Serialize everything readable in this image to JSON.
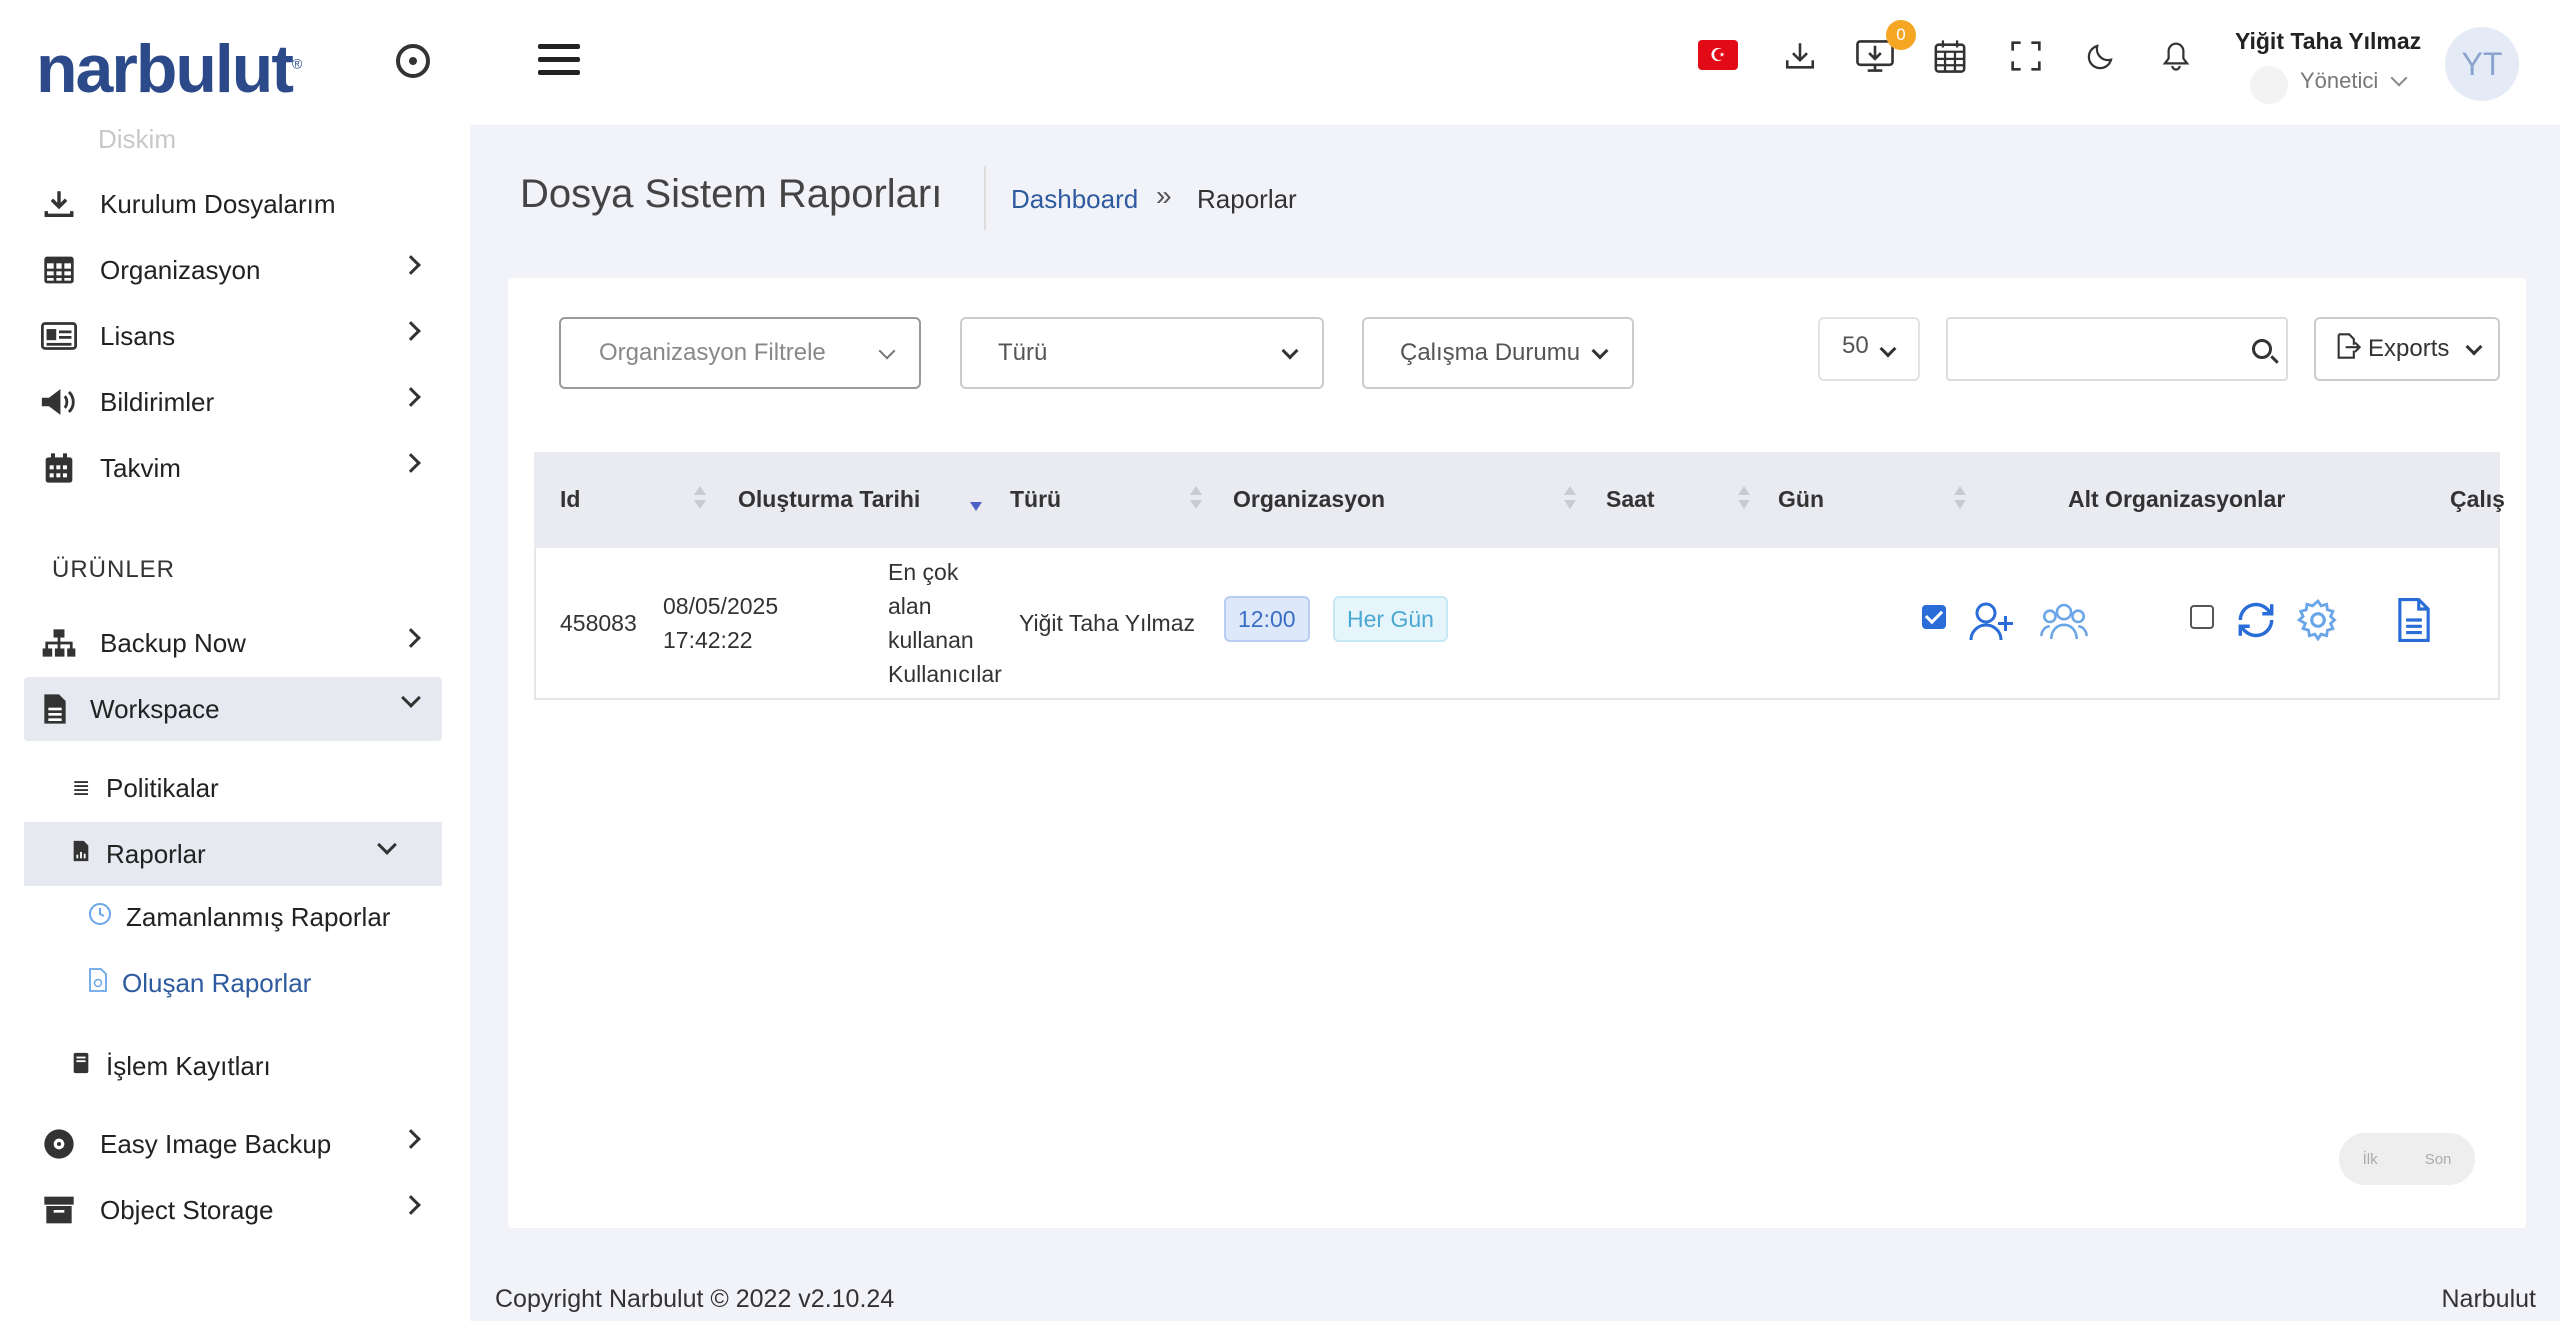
{
  "brand": {
    "logo": "narbulut",
    "logo_mark": "®"
  },
  "sidebar": {
    "ghost_item": "Diskim",
    "items": [
      {
        "label": "Kurulum Dosyalarım",
        "icon": "download-icon"
      },
      {
        "label": "Organizasyon",
        "icon": "table-grid-icon"
      },
      {
        "label": "Lisans",
        "icon": "id-card-icon"
      },
      {
        "label": "Bildirimler",
        "icon": "megaphone-icon"
      },
      {
        "label": "Takvim",
        "icon": "calendar-icon"
      }
    ],
    "section": "ÜRÜNLER",
    "products": [
      {
        "label": "Backup Now",
        "icon": "sitemap-icon"
      },
      {
        "label": "Workspace",
        "icon": "file-icon"
      }
    ],
    "workspace_children": [
      {
        "label": "Politikalar",
        "icon": "list-icon"
      },
      {
        "label": "Raporlar",
        "icon": "file-chart-icon"
      }
    ],
    "raporlar_children": [
      {
        "label": "Zamanlanmış Raporlar",
        "icon": "clock-icon"
      },
      {
        "label": "Oluşan Raporlar",
        "icon": "file-doc-icon"
      }
    ],
    "islem": {
      "label": "İşlem Kayıtları",
      "icon": "book-icon"
    },
    "bottom": [
      {
        "label": "Easy Image Backup",
        "icon": "disc-icon"
      },
      {
        "label": "Object Storage",
        "icon": "archive-icon"
      }
    ]
  },
  "header": {
    "flag_glyph": "☪",
    "notification_count": "0",
    "user_name": "Yiğit Taha Yılmaz",
    "user_role": "Yönetici",
    "avatar_initials": "YT"
  },
  "page": {
    "title": "Dosya Sistem Raporları",
    "breadcrumb": [
      "Dashboard",
      "»",
      "Raporlar"
    ]
  },
  "filters": {
    "organization": "Organizasyon Filtrele",
    "type": "Türü",
    "status": "Çalışma Durumu",
    "page_size": "50",
    "search_placeholder": "",
    "exports": "Exports"
  },
  "table": {
    "columns": [
      "Id",
      "Oluşturma Tarihi",
      "Türü",
      "Organizasyon",
      "Saat",
      "Gün",
      "Alt Organizasyonlar",
      "Çalış"
    ],
    "rows": [
      {
        "id": "458083",
        "date_line1": "08/05/2025",
        "date_line2": "17:42:22",
        "type_lines": [
          "En çok",
          "alan",
          "kullanan",
          "Kullanıcılar"
        ],
        "organization": "Yiğit Taha Yılmaz",
        "time": "12:00",
        "day": "Her Gün"
      }
    ]
  },
  "pagination": {
    "first": "İlk",
    "last": "Son"
  },
  "footer": {
    "copyright": "Copyright Narbulut © 2022  v2.10.24",
    "brand": "Narbulut"
  }
}
